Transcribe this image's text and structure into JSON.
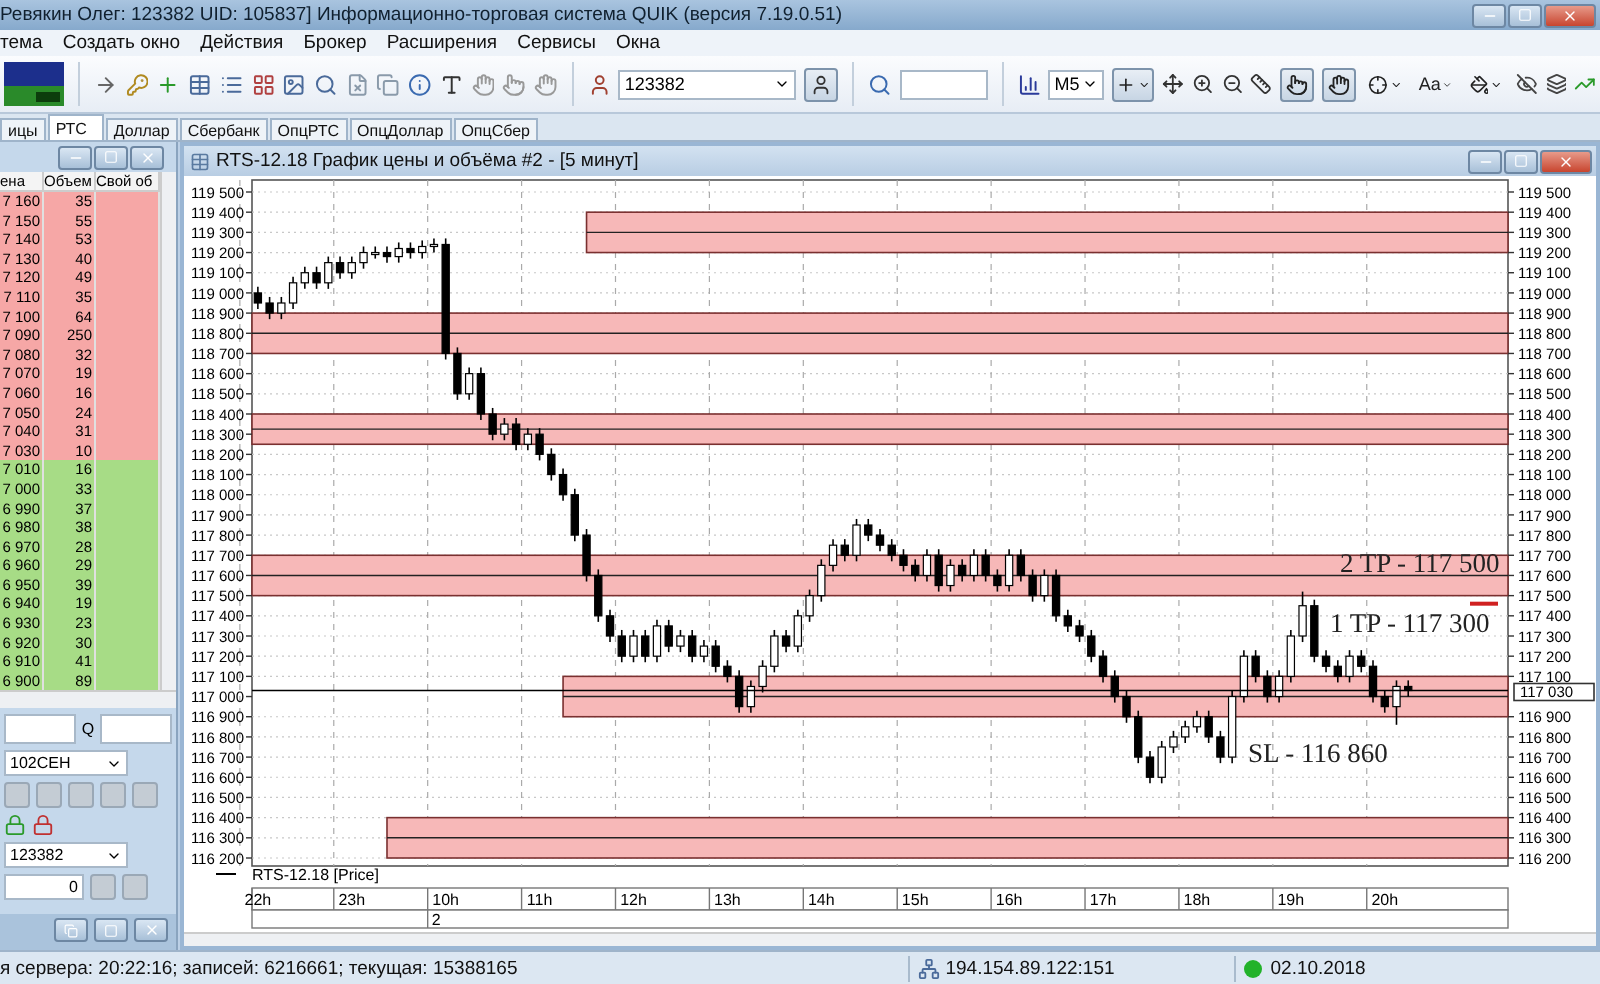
{
  "window": {
    "title": "Ревякин Олег: 123382 UID: 105837] Информационно-торговая система QUIK (версия 7.19.0.51)"
  },
  "menu": [
    "тема",
    "Создать окно",
    "Действия",
    "Брокер",
    "Расширения",
    "Сервисы",
    "Окна"
  ],
  "toolbar": {
    "account": "123382",
    "timeframe": "M5",
    "font_tool": "Aa"
  },
  "tabs": [
    {
      "label": "ицы",
      "selected": false
    },
    {
      "label": "РТС",
      "selected": true
    },
    {
      "label": "Доллар",
      "selected": false
    },
    {
      "label": "Сбербанк",
      "selected": false
    },
    {
      "label": "ОпцРТС",
      "selected": false
    },
    {
      "label": "ОпцДоллар",
      "selected": false
    },
    {
      "label": "ОпцСбер",
      "selected": false
    }
  ],
  "order_book": {
    "columns": [
      "ена",
      "Объем",
      "Свой об"
    ],
    "rows": [
      {
        "kind": "ask",
        "price": "7 160",
        "volume": "35"
      },
      {
        "kind": "ask",
        "price": "7 150",
        "volume": "55"
      },
      {
        "kind": "ask",
        "price": "7 140",
        "volume": "53"
      },
      {
        "kind": "ask",
        "price": "7 130",
        "volume": "40"
      },
      {
        "kind": "ask",
        "price": "7 120",
        "volume": "49"
      },
      {
        "kind": "ask",
        "price": "7 110",
        "volume": "35"
      },
      {
        "kind": "ask",
        "price": "7 100",
        "volume": "64"
      },
      {
        "kind": "ask",
        "price": "7 090",
        "volume": "250"
      },
      {
        "kind": "ask",
        "price": "7 080",
        "volume": "32"
      },
      {
        "kind": "ask",
        "price": "7 070",
        "volume": "19"
      },
      {
        "kind": "ask",
        "price": "7 060",
        "volume": "16"
      },
      {
        "kind": "ask",
        "price": "7 050",
        "volume": "24"
      },
      {
        "kind": "ask",
        "price": "7 040",
        "volume": "31"
      },
      {
        "kind": "ask",
        "price": "7 030",
        "volume": "10"
      },
      {
        "kind": "bid",
        "price": "7 010",
        "volume": "16"
      },
      {
        "kind": "bid",
        "price": "7 000",
        "volume": "33"
      },
      {
        "kind": "bid",
        "price": "6 990",
        "volume": "37"
      },
      {
        "kind": "bid",
        "price": "6 980",
        "volume": "38"
      },
      {
        "kind": "bid",
        "price": "6 970",
        "volume": "28"
      },
      {
        "kind": "bid",
        "price": "6 960",
        "volume": "29"
      },
      {
        "kind": "bid",
        "price": "6 950",
        "volume": "39"
      },
      {
        "kind": "bid",
        "price": "6 940",
        "volume": "19"
      },
      {
        "kind": "bid",
        "price": "6 930",
        "volume": "23"
      },
      {
        "kind": "bid",
        "price": "6 920",
        "volume": "30"
      },
      {
        "kind": "bid",
        "price": "6 910",
        "volume": "41"
      },
      {
        "kind": "bid",
        "price": "6 900",
        "volume": "89"
      }
    ]
  },
  "order_form": {
    "q_label": "Q",
    "instrument": "102CEH",
    "account": "123382",
    "quantity": "0"
  },
  "chart_window": {
    "title": "RTS-12.18 График цены и объёма #2 - [5 минут]",
    "date_label": "2",
    "left_axis": [
      "119 500",
      "119 400",
      "119 300",
      "119 200",
      "119 100",
      "119 000",
      "118 900",
      "118 800",
      "118 700",
      "118 600",
      "118 500",
      "118 400",
      "118 300",
      "118 200",
      "118 100",
      "118 000",
      "117 900",
      "117 800",
      "117 700",
      "117 600",
      "117 500",
      "117 400",
      "117 300",
      "117 200",
      "117 100",
      "117 000",
      "116 900",
      "116 800",
      "116 700",
      "116 600",
      "116 500",
      "116 400",
      "116 300",
      "116 200"
    ],
    "chart_data": {
      "type": "candlestick",
      "ylim": [
        116200,
        119500
      ],
      "grid": true,
      "bands": [
        {
          "axis": "y",
          "from": 119200,
          "to": 119400
        },
        {
          "axis": "y",
          "from": 118700,
          "to": 118900
        },
        {
          "axis": "y",
          "from": 118250,
          "to": 118400
        },
        {
          "axis": "y",
          "from": 117500,
          "to": 117700
        },
        {
          "axis": "y",
          "from": 116900,
          "to": 117100
        },
        {
          "axis": "y",
          "from": 116200,
          "to": 116400
        }
      ],
      "categories": [
        "22h",
        null,
        null,
        null,
        null,
        null,
        null,
        null,
        "23h",
        null,
        null,
        null,
        null,
        null,
        null,
        null,
        "10h",
        null,
        null,
        null,
        null,
        null,
        null,
        null,
        "11h",
        null,
        null,
        null,
        null,
        null,
        null,
        null,
        "12h",
        null,
        null,
        null,
        null,
        null,
        null,
        null,
        "13h",
        null,
        null,
        null,
        null,
        null,
        null,
        null,
        "14h",
        null,
        null,
        null,
        null,
        null,
        null,
        null,
        "15h",
        null,
        null,
        null,
        null,
        null,
        null,
        null,
        "16h",
        null,
        null,
        null,
        null,
        null,
        null,
        null,
        "17h",
        null,
        null,
        null,
        null,
        null,
        null,
        null,
        "18h",
        null,
        null,
        null,
        null,
        null,
        null,
        null,
        "19h",
        null,
        null,
        null,
        null,
        null,
        null,
        null,
        "20h",
        null,
        null,
        null,
        null,
        null,
        null,
        null,
        null,
        null,
        null
      ],
      "series": [
        {
          "name": "RTS-12.18 [Price]",
          "color": "#000000",
          "ohlc": [
            [
              119000,
              119030,
              118920,
              118950
            ],
            [
              118950,
              118980,
              118870,
              118900
            ],
            [
              118900,
              118980,
              118870,
              118950
            ],
            [
              118950,
              119080,
              118920,
              119050
            ],
            [
              119050,
              119130,
              119020,
              119100
            ],
            [
              119100,
              119130,
              119020,
              119050
            ],
            [
              119050,
              119180,
              119020,
              119150
            ],
            [
              119150,
              119180,
              119070,
              119100
            ],
            [
              119100,
              119180,
              119070,
              119150
            ],
            [
              119150,
              119230,
              119120,
              119200
            ],
            [
              119200,
              119230,
              119170,
              119200
            ],
            [
              119200,
              119230,
              119150,
              119180
            ],
            [
              119180,
              119250,
              119150,
              119220
            ],
            [
              119220,
              119250,
              119170,
              119200
            ],
            [
              119200,
              119260,
              119170,
              119230
            ],
            [
              119230,
              119270,
              119200,
              119240
            ],
            [
              119240,
              119270,
              118670,
              118700
            ],
            [
              118700,
              118730,
              118470,
              118500
            ],
            [
              118500,
              118630,
              118470,
              118600
            ],
            [
              118600,
              118630,
              118370,
              118400
            ],
            [
              118400,
              118430,
              118270,
              118300
            ],
            [
              118300,
              118380,
              118270,
              118350
            ],
            [
              118350,
              118380,
              118220,
              118250
            ],
            [
              118250,
              118330,
              118220,
              118300
            ],
            [
              118300,
              118330,
              118170,
              118200
            ],
            [
              118200,
              118230,
              118070,
              118100
            ],
            [
              118100,
              118130,
              117970,
              118000
            ],
            [
              118000,
              118030,
              117770,
              117800
            ],
            [
              117800,
              117830,
              117570,
              117600
            ],
            [
              117600,
              117630,
              117370,
              117400
            ],
            [
              117400,
              117430,
              117270,
              117300
            ],
            [
              117300,
              117330,
              117170,
              117200
            ],
            [
              117200,
              117330,
              117170,
              117300
            ],
            [
              117300,
              117330,
              117170,
              117200
            ],
            [
              117200,
              117380,
              117170,
              117350
            ],
            [
              117350,
              117380,
              117220,
              117250
            ],
            [
              117250,
              117330,
              117220,
              117300
            ],
            [
              117300,
              117330,
              117170,
              117200
            ],
            [
              117200,
              117280,
              117170,
              117250
            ],
            [
              117250,
              117280,
              117120,
              117150
            ],
            [
              117150,
              117180,
              117070,
              117100
            ],
            [
              117100,
              117130,
              116920,
              116950
            ],
            [
              116950,
              117080,
              116920,
              117050
            ],
            [
              117050,
              117180,
              117020,
              117150
            ],
            [
              117150,
              117330,
              117120,
              117300
            ],
            [
              117300,
              117330,
              117220,
              117250
            ],
            [
              117250,
              117430,
              117220,
              117400
            ],
            [
              117400,
              117530,
              117370,
              117500
            ],
            [
              117500,
              117680,
              117470,
              117650
            ],
            [
              117650,
              117780,
              117620,
              117750
            ],
            [
              117750,
              117780,
              117670,
              117700
            ],
            [
              117700,
              117880,
              117670,
              117850
            ],
            [
              117850,
              117880,
              117770,
              117800
            ],
            [
              117800,
              117830,
              117720,
              117750
            ],
            [
              117750,
              117780,
              117670,
              117700
            ],
            [
              117700,
              117730,
              117620,
              117650
            ],
            [
              117650,
              117680,
              117570,
              117600
            ],
            [
              117600,
              117730,
              117570,
              117700
            ],
            [
              117700,
              117730,
              117520,
              117550
            ],
            [
              117550,
              117680,
              117520,
              117650
            ],
            [
              117650,
              117680,
              117570,
              117600
            ],
            [
              117600,
              117730,
              117570,
              117700
            ],
            [
              117700,
              117730,
              117570,
              117600
            ],
            [
              117600,
              117630,
              117520,
              117550
            ],
            [
              117550,
              117730,
              117520,
              117700
            ],
            [
              117700,
              117730,
              117570,
              117600
            ],
            [
              117600,
              117630,
              117470,
              117500
            ],
            [
              117500,
              117630,
              117470,
              117600
            ],
            [
              117600,
              117630,
              117370,
              117400
            ],
            [
              117400,
              117430,
              117320,
              117350
            ],
            [
              117350,
              117380,
              117270,
              117300
            ],
            [
              117300,
              117330,
              117170,
              117200
            ],
            [
              117200,
              117230,
              117070,
              117100
            ],
            [
              117100,
              117130,
              116970,
              117000
            ],
            [
              117000,
              117030,
              116870,
              116900
            ],
            [
              116900,
              116930,
              116670,
              116700
            ],
            [
              116700,
              116730,
              116570,
              116600
            ],
            [
              116600,
              116780,
              116570,
              116750
            ],
            [
              116750,
              116830,
              116720,
              116800
            ],
            [
              116800,
              116880,
              116770,
              116850
            ],
            [
              116850,
              116930,
              116820,
              116900
            ],
            [
              116900,
              116930,
              116770,
              116800
            ],
            [
              116800,
              116830,
              116670,
              116700
            ],
            [
              116700,
              117030,
              116670,
              117000
            ],
            [
              117000,
              117230,
              116970,
              117200
            ],
            [
              117200,
              117230,
              117070,
              117100
            ],
            [
              117100,
              117130,
              116970,
              117000
            ],
            [
              117000,
              117130,
              116970,
              117100
            ],
            [
              117100,
              117330,
              117070,
              117300
            ],
            [
              117300,
              117520,
              117270,
              117450
            ],
            [
              117450,
              117480,
              117170,
              117200
            ],
            [
              117200,
              117230,
              117120,
              117150
            ],
            [
              117150,
              117180,
              117070,
              117100
            ],
            [
              117100,
              117230,
              117070,
              117200
            ],
            [
              117200,
              117230,
              117120,
              117150
            ],
            [
              117150,
              117180,
              116970,
              117000
            ],
            [
              117000,
              117030,
              116920,
              116950
            ],
            [
              116950,
              117080,
              116860,
              117050
            ],
            [
              117050,
              117080,
              117000,
              117030
            ],
            null,
            null,
            null,
            null,
            null,
            null,
            null,
            null
          ]
        }
      ],
      "yticks": [
        {
          "value": 119500,
          "label": "119 500"
        },
        {
          "value": 119400,
          "label": "119 400"
        },
        {
          "value": 119300,
          "label": "119 300"
        },
        {
          "value": 119200,
          "label": "119 200"
        },
        {
          "value": 119100,
          "label": "119 100"
        },
        {
          "value": 119000,
          "label": "119 000"
        },
        {
          "value": 118900,
          "label": "118 900"
        },
        {
          "value": 118800,
          "label": "118 800"
        },
        {
          "value": 118700,
          "label": "118 700"
        },
        {
          "value": 118600,
          "label": "118 600"
        },
        {
          "value": 118500,
          "label": "118 500"
        },
        {
          "value": 118400,
          "label": "118 400"
        },
        {
          "value": 118300,
          "label": "118 300"
        },
        {
          "value": 118200,
          "label": "118 200"
        },
        {
          "value": 118100,
          "label": "118 100"
        },
        {
          "value": 118000,
          "label": "118 000"
        },
        {
          "value": 117900,
          "label": "117 900"
        },
        {
          "value": 117800,
          "label": "117 800"
        },
        {
          "value": 117700,
          "label": "117 700"
        },
        {
          "value": 117600,
          "label": "117 600"
        },
        {
          "value": 117500,
          "label": "117 500"
        },
        {
          "value": 117400,
          "label": "117 400"
        },
        {
          "value": 117300,
          "label": "117 300"
        },
        {
          "value": 117200,
          "label": "117 200"
        },
        {
          "value": 117100,
          "label": "117 100"
        },
        {
          "value": 116900,
          "label": "116 900"
        },
        {
          "value": 116800,
          "label": "116 800"
        },
        {
          "value": 116700,
          "label": "116 700"
        },
        {
          "value": 116600,
          "label": "116 600"
        },
        {
          "value": 116500,
          "label": "116 500"
        },
        {
          "value": 116400,
          "label": "116 400"
        },
        {
          "value": 116300,
          "label": "116 300"
        },
        {
          "value": 116200,
          "label": "116 200"
        }
      ],
      "ref_lines": [
        {
          "axis": "y",
          "value": 117030,
          "label": "117 030"
        }
      ],
      "annotations": [
        "2 TP - 117 500",
        "1 TP - 117 300",
        "SL - 116 860"
      ]
    }
  },
  "status_bar": {
    "server": "я сервера: 20:22:16; записей: 6216661; текущая: 15388165",
    "connection": "194.154.89.122:151",
    "connected": true,
    "date": "02.10.2018"
  }
}
